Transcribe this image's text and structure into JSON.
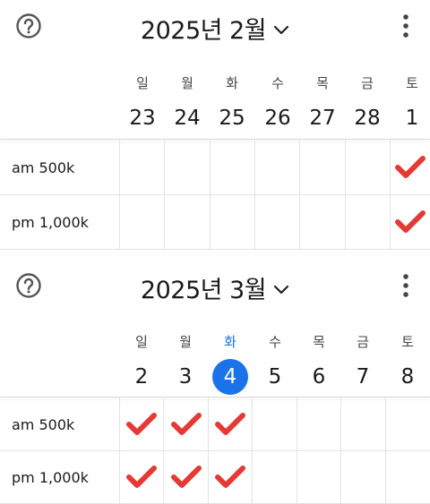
{
  "accent_color": "#1a73e8",
  "check_color": "#e53935",
  "calendars": [
    {
      "title": "2025년 2월",
      "days": [
        {
          "name": "일",
          "num": "23",
          "today": false
        },
        {
          "name": "월",
          "num": "24",
          "today": false
        },
        {
          "name": "화",
          "num": "25",
          "today": false
        },
        {
          "name": "수",
          "num": "26",
          "today": false
        },
        {
          "name": "목",
          "num": "27",
          "today": false
        },
        {
          "name": "금",
          "num": "28",
          "today": false
        },
        {
          "name": "토",
          "num": "1",
          "today": false
        }
      ],
      "rows": [
        {
          "label": "am 500k",
          "checks": [
            false,
            false,
            false,
            false,
            false,
            false,
            true
          ]
        },
        {
          "label": "pm 1,000k",
          "checks": [
            false,
            false,
            false,
            false,
            false,
            false,
            true
          ]
        }
      ]
    },
    {
      "title": "2025년 3월",
      "days": [
        {
          "name": "일",
          "num": "2",
          "today": false
        },
        {
          "name": "월",
          "num": "3",
          "today": false
        },
        {
          "name": "화",
          "num": "4",
          "today": true
        },
        {
          "name": "수",
          "num": "5",
          "today": false
        },
        {
          "name": "목",
          "num": "6",
          "today": false
        },
        {
          "name": "금",
          "num": "7",
          "today": false
        },
        {
          "name": "토",
          "num": "8",
          "today": false
        }
      ],
      "rows": [
        {
          "label": "am 500k",
          "checks": [
            true,
            true,
            true,
            false,
            false,
            false,
            false
          ]
        },
        {
          "label": "pm 1,000k",
          "checks": [
            true,
            true,
            true,
            false,
            false,
            false,
            false
          ]
        }
      ]
    }
  ]
}
